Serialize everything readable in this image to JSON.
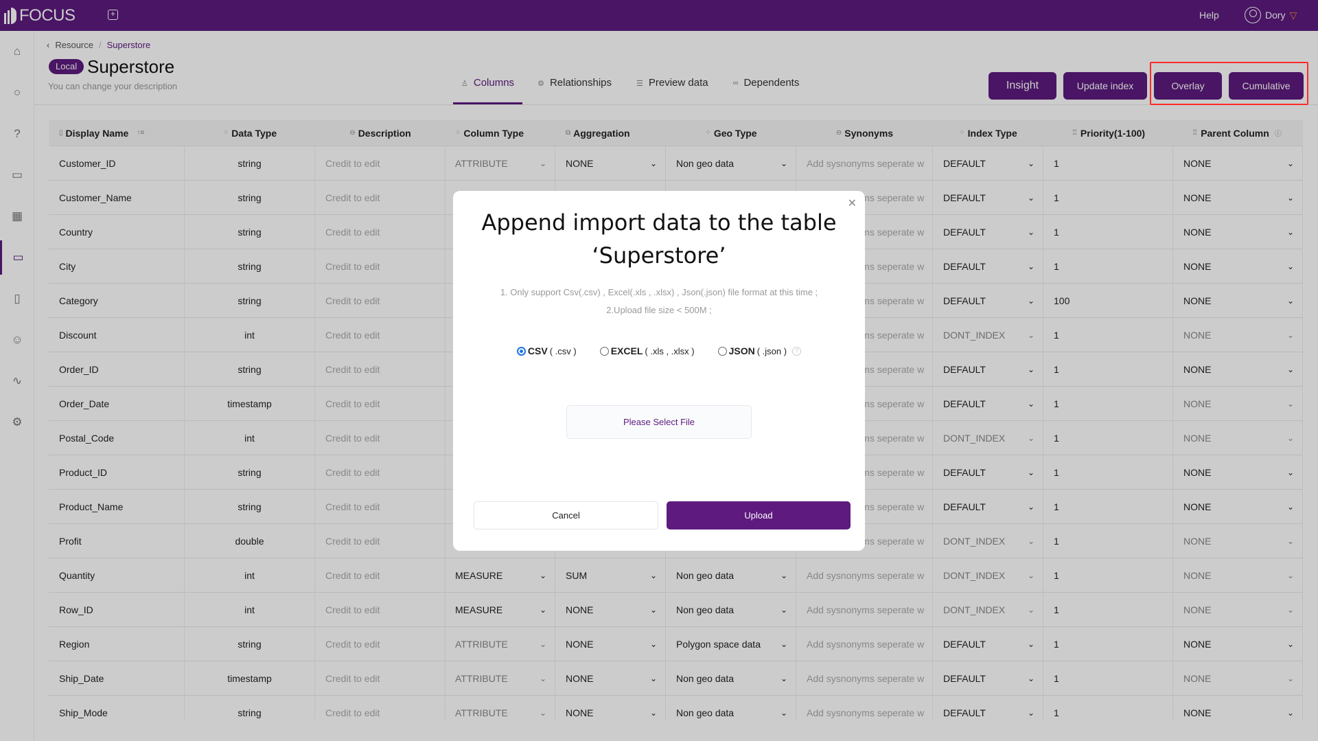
{
  "app": {
    "name": "FOCUS",
    "help": "Help",
    "user": "Dory",
    "brand_color": "#5c1b7e"
  },
  "sidebar": {
    "items": [
      {
        "icon": "home-icon",
        "glyph": "⌂"
      },
      {
        "icon": "search-icon",
        "glyph": "○"
      },
      {
        "icon": "help-icon",
        "glyph": "?"
      },
      {
        "icon": "presentation-icon",
        "glyph": "▭"
      },
      {
        "icon": "table-icon",
        "glyph": "▦"
      },
      {
        "icon": "folder-icon",
        "glyph": "▭",
        "active": true
      },
      {
        "icon": "clipboard-icon",
        "glyph": "▯"
      },
      {
        "icon": "user-icon",
        "glyph": "☺"
      },
      {
        "icon": "activity-icon",
        "glyph": "∿"
      },
      {
        "icon": "settings-icon",
        "glyph": "⚙"
      }
    ]
  },
  "breadcrumb": {
    "back": "Resource",
    "current": "Superstore"
  },
  "header": {
    "badge": "Local",
    "title": "Superstore",
    "description": "You can change your description"
  },
  "tabs": [
    {
      "label": "Columns",
      "icon": "person",
      "active": true
    },
    {
      "label": "Relationships",
      "icon": "gear"
    },
    {
      "label": "Preview data",
      "icon": "database"
    },
    {
      "label": "Dependents",
      "icon": "link"
    }
  ],
  "actions": {
    "insight": "Insight",
    "update_index": "Update index",
    "overlay": "Overlay",
    "cumulative": "Cumulative"
  },
  "table": {
    "headers": [
      "Display Name",
      "Data Type",
      "Description",
      "Column Type",
      "Aggregation",
      "Geo Type",
      "Synonyms",
      "Index Type",
      "Priority(1-100)",
      "Parent Column"
    ],
    "description_placeholder": "Credit to edit",
    "synonyms_placeholder": "Add sysnonyms seperate w",
    "rows": [
      {
        "name": "Customer_ID",
        "type": "string",
        "col_type": "ATTRIBUTE",
        "col_dim": true,
        "agg": "NONE",
        "geo": "Non geo data",
        "index": "DEFAULT",
        "priority": "1",
        "parent": "NONE",
        "parent_dim": false
      },
      {
        "name": "Customer_Name",
        "type": "string",
        "index": "DEFAULT",
        "priority": "1",
        "parent": "NONE",
        "parent_dim": false
      },
      {
        "name": "Country",
        "type": "string",
        "index": "DEFAULT",
        "priority": "1",
        "parent": "NONE",
        "parent_dim": false
      },
      {
        "name": "City",
        "type": "string",
        "index": "DEFAULT",
        "priority": "1",
        "parent": "NONE",
        "parent_dim": false
      },
      {
        "name": "Category",
        "type": "string",
        "index": "DEFAULT",
        "priority": "100",
        "parent": "NONE",
        "parent_dim": false
      },
      {
        "name": "Discount",
        "type": "int",
        "index": "DONT_INDEX",
        "priority": "1",
        "parent": "NONE",
        "parent_dim": true
      },
      {
        "name": "Order_ID",
        "type": "string",
        "index": "DEFAULT",
        "priority": "1",
        "parent": "NONE",
        "parent_dim": false
      },
      {
        "name": "Order_Date",
        "type": "timestamp",
        "index": "DEFAULT",
        "priority": "1",
        "parent": "NONE",
        "parent_dim": true
      },
      {
        "name": "Postal_Code",
        "type": "int",
        "index": "DONT_INDEX",
        "priority": "1",
        "parent": "NONE",
        "parent_dim": true
      },
      {
        "name": "Product_ID",
        "type": "string",
        "index": "DEFAULT",
        "priority": "1",
        "parent": "NONE",
        "parent_dim": false
      },
      {
        "name": "Product_Name",
        "type": "string",
        "index": "DEFAULT",
        "priority": "1",
        "parent": "NONE",
        "parent_dim": false
      },
      {
        "name": "Profit",
        "type": "double",
        "index": "DONT_INDEX",
        "priority": "1",
        "parent": "NONE",
        "parent_dim": true
      },
      {
        "name": "Quantity",
        "type": "int",
        "col_type": "MEASURE",
        "col_dim": false,
        "agg": "SUM",
        "geo": "Non geo data",
        "index": "DONT_INDEX",
        "priority": "1",
        "parent": "NONE",
        "parent_dim": true
      },
      {
        "name": "Row_ID",
        "type": "int",
        "col_type": "MEASURE",
        "col_dim": false,
        "agg": "NONE",
        "geo": "Non geo data",
        "index": "DONT_INDEX",
        "priority": "1",
        "parent": "NONE",
        "parent_dim": true
      },
      {
        "name": "Region",
        "type": "string",
        "col_type": "ATTRIBUTE",
        "col_dim": true,
        "agg": "NONE",
        "geo": "Polygon space data",
        "index": "DEFAULT",
        "priority": "1",
        "parent": "NONE",
        "parent_dim": false
      },
      {
        "name": "Ship_Date",
        "type": "timestamp",
        "col_type": "ATTRIBUTE",
        "col_dim": true,
        "agg": "NONE",
        "geo": "Non geo data",
        "index": "DEFAULT",
        "priority": "1",
        "parent": "NONE",
        "parent_dim": true
      },
      {
        "name": "Ship_Mode",
        "type": "string",
        "col_type": "ATTRIBUTE",
        "col_dim": true,
        "agg": "NONE",
        "geo": "Non geo data",
        "index": "DEFAULT",
        "priority": "1",
        "parent": "NONE",
        "parent_dim": false
      }
    ]
  },
  "modal": {
    "title_line1": "Append import data to the table",
    "title_line2": "‘Superstore’",
    "note1": "1. Only support  Csv(.csv) , Excel(.xls , .xlsx) , Json(.json)  file format at this time ;",
    "note2": "2.Upload file size  < 500M  ;",
    "options": [
      {
        "bold": "CSV",
        "ext": "( .csv )",
        "selected": true
      },
      {
        "bold": "EXCEL",
        "ext": "( .xls , .xlsx )",
        "selected": false
      },
      {
        "bold": "JSON",
        "ext": "( .json )",
        "selected": false
      }
    ],
    "select_file": "Please Select File",
    "cancel": "Cancel",
    "upload": "Upload"
  }
}
